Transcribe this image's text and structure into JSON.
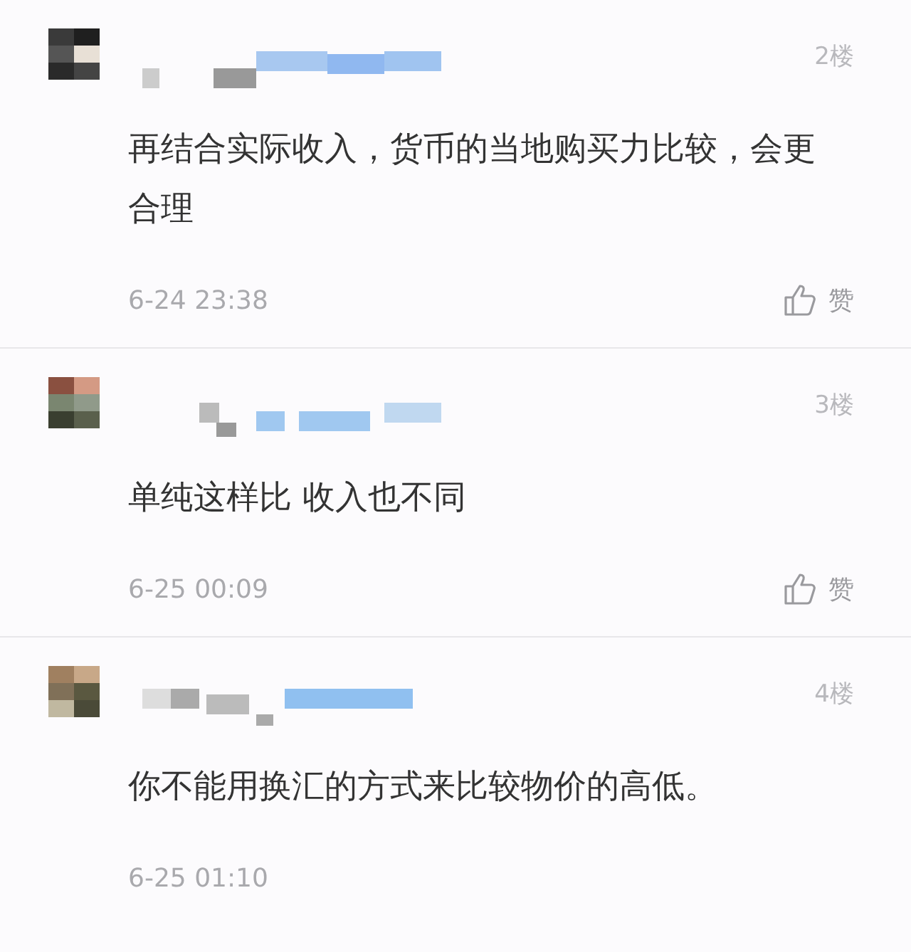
{
  "comments": [
    {
      "floor": "2楼",
      "text": "再结合实际收入，货币的当地购买力比较，会更合理",
      "time": "6-24 23:38",
      "like_label": "赞"
    },
    {
      "floor": "3楼",
      "text": "单纯这样比 收入也不同",
      "time": "6-25 00:09",
      "like_label": "赞"
    },
    {
      "floor": "4楼",
      "text": "你不能用换汇的方式来比较物价的高低。",
      "time": "6-25 01:10"
    }
  ]
}
